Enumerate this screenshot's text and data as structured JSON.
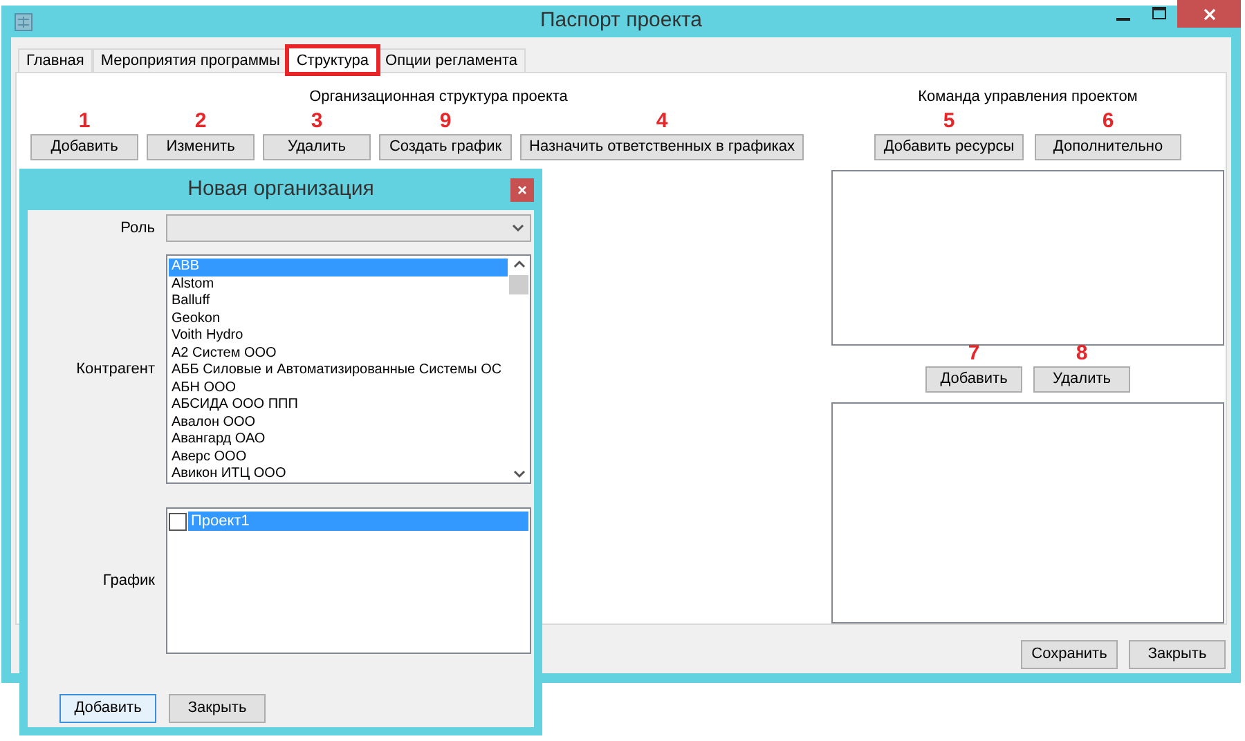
{
  "window": {
    "title": "Паспорт проекта"
  },
  "tabs": [
    {
      "label": "Главная",
      "selected": false,
      "highlighted": false
    },
    {
      "label": "Мероприятия программы",
      "selected": false,
      "highlighted": false
    },
    {
      "label": "Структура",
      "selected": true,
      "highlighted": true
    },
    {
      "label": "Опции регламента",
      "selected": false,
      "highlighted": false
    }
  ],
  "org_structure": {
    "heading": "Организационная структура проекта",
    "buttons": [
      {
        "marker": "1",
        "label": "Добавить"
      },
      {
        "marker": "2",
        "label": "Изменить"
      },
      {
        "marker": "3",
        "label": "Удалить"
      },
      {
        "marker": "9",
        "label": "Создать график"
      },
      {
        "marker": "4",
        "label": "Назначить ответственных в графиках"
      }
    ]
  },
  "team": {
    "heading": "Команда управления проектом",
    "buttons": [
      {
        "marker": "5",
        "label": "Добавить ресурсы"
      },
      {
        "marker": "6",
        "label": "Дополнительно"
      }
    ],
    "list_buttons": [
      {
        "marker": "7",
        "label": "Добавить"
      },
      {
        "marker": "8",
        "label": "Удалить"
      }
    ]
  },
  "footer_buttons": [
    "Сохранить",
    "Закрыть"
  ],
  "dialog": {
    "title": "Новая организация",
    "role": {
      "label": "Роль"
    },
    "counterparty": {
      "label": "Контрагент",
      "items": [
        {
          "text": "ABB",
          "selected": true
        },
        {
          "text": "Alstom",
          "selected": false
        },
        {
          "text": "Balluff",
          "selected": false
        },
        {
          "text": "Geokon",
          "selected": false
        },
        {
          "text": "Voith Hydro",
          "selected": false
        },
        {
          "text": "А2 Систем ООО",
          "selected": false
        },
        {
          "text": "АББ Силовые и Автоматизированные Системы ОС",
          "selected": false
        },
        {
          "text": "АБН ООО",
          "selected": false
        },
        {
          "text": "АБСИДА ООО ППП",
          "selected": false
        },
        {
          "text": "Авалон ООО",
          "selected": false
        },
        {
          "text": "Авангард ОАО",
          "selected": false
        },
        {
          "text": "Аверс ООО",
          "selected": false
        },
        {
          "text": "Авикон ИТЦ ООО",
          "selected": false
        }
      ]
    },
    "schedule": {
      "label": "График",
      "items": [
        {
          "text": "Проект1",
          "selected": true,
          "checked": false
        }
      ]
    },
    "buttons": [
      {
        "label": "Добавить",
        "focused": true
      },
      {
        "label": "Закрыть",
        "focused": false
      }
    ]
  }
}
